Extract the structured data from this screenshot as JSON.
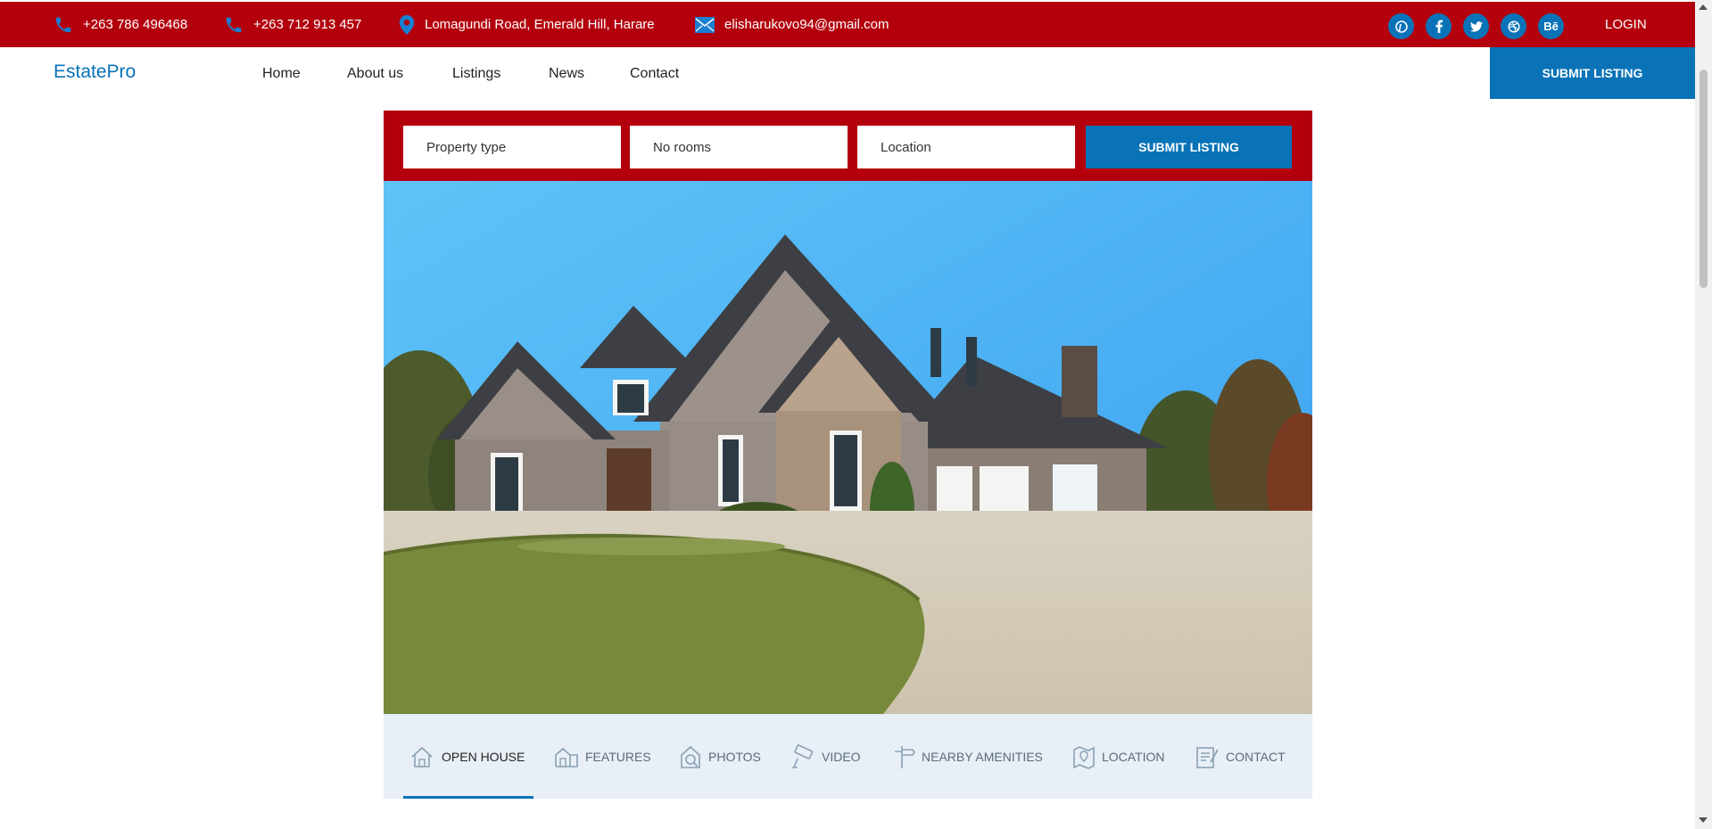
{
  "topbar": {
    "phone1": "+263 786 496468",
    "phone2": "+263 712 913 457",
    "address": "Lomagundi Road, Emerald Hill, Harare",
    "email": "elisharukovo94@gmail.com",
    "social": [
      "pinterest-icon",
      "facebook-icon",
      "twitter-icon",
      "dribbble-icon",
      "behance-icon"
    ],
    "behance_text": "Bē",
    "login": "LOGIN"
  },
  "nav": {
    "brand": "EstatePro",
    "links": [
      "Home",
      "About us",
      "Listings",
      "News",
      "Contact"
    ],
    "submit": "SUBMIT LISTING"
  },
  "search": {
    "property_type": "Property type",
    "rooms": "No rooms",
    "location": "Location",
    "submit": "SUBMIT LISTING"
  },
  "tabs": [
    {
      "label": "OPEN HOUSE",
      "icon": "open-house-icon",
      "active": true
    },
    {
      "label": "FEATURES",
      "icon": "features-icon"
    },
    {
      "label": "PHOTOS",
      "icon": "photos-icon"
    },
    {
      "label": "VIDEO",
      "icon": "video-camera-icon"
    },
    {
      "label": "NEARBY AMENITIES",
      "icon": "signpost-icon"
    },
    {
      "label": "LOCATION",
      "icon": "map-icon"
    },
    {
      "label": "CONTACT",
      "icon": "contact-form-icon"
    }
  ],
  "colors": {
    "brand_red": "#b3000c",
    "brand_blue": "#0a73b8",
    "tab_bg": "#e8eff6"
  }
}
